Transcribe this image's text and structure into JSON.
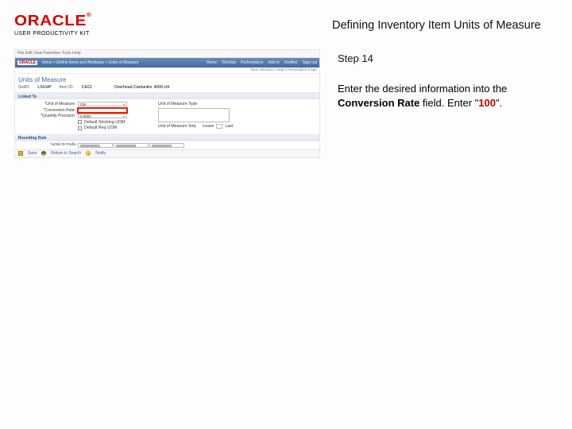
{
  "logo": {
    "word": "ORACLE",
    "tm": "®",
    "subtitle": "USER PRODUCTIVITY KIT"
  },
  "page_title": "Defining Inventory Item Units of Measure",
  "step": "Step 14",
  "instruction": {
    "pre": "Enter the desired information into the ",
    "bold1": "Conversion Rate",
    "mid": " field. Enter \"",
    "value": "100",
    "post": "\"."
  },
  "shot": {
    "browser_line": "File Edit   View   Favorites   Tools   Help",
    "breadcrumb": "Items  >  Define Items and Attributes  >  Units of Measure",
    "nav": {
      "logo": "ORACLE",
      "items": [
        "Home",
        "Worklist",
        "Performance",
        "Add to",
        "Notifies",
        "Sign out"
      ]
    },
    "subbar": "New Window | Help | Personalize Page",
    "uom_title": "Units of Measure",
    "fields": {
      "setid_lbl": "SetID:",
      "setid": "LSUHP",
      "itemid_lbl": "Item ID:",
      "itemid": "CH11",
      "desc": "Overhead Cantankiv. 4000.cth"
    },
    "linked_to": "Linked To",
    "left": {
      "uom_lbl": "*Unit of Measure:",
      "uom": "CM",
      "convrate_lbl": "*Conversion Rate:",
      "convrate": "",
      "qprec_lbl": "*Quantity Precision:",
      "qprec": "0.0001",
      "opts": [
        "Default Stocking UOM",
        "Default Req UOM"
      ]
    },
    "right": {
      "type_lbl": "Unit of Measure Type",
      "type": "",
      "seq_lbl": "Unit of Measure Seq",
      "leave": "Leave",
      "last": "Last"
    },
    "rounding": "Rounding Rule",
    "prefix_lbl": "*UOM ID Prefix:",
    "prefixes": [
      "0000000001",
      "0000000000",
      "0000000000"
    ],
    "footer": {
      "save": "Save",
      "return": "Return to Search",
      "notify": "Notify"
    }
  }
}
